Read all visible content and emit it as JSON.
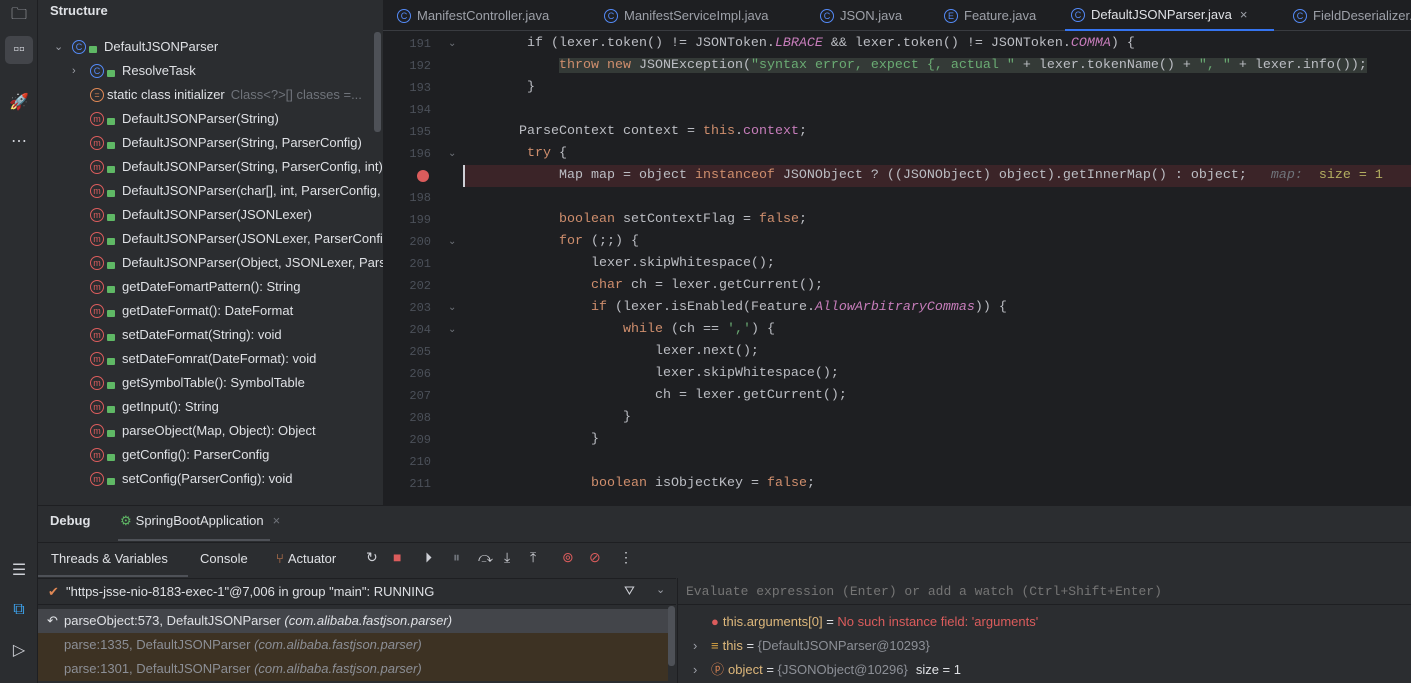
{
  "sidebar_icons": [
    "folder-icon",
    "structure-icon",
    "jrebel-icon",
    "more-icon"
  ],
  "sidebar_bottom_icons": [
    "list-icon",
    "code-with-me-icon",
    "run-icon"
  ],
  "structure": {
    "title": "Structure",
    "items": [
      {
        "kind": "c",
        "label": "DefaultJSONParser",
        "arrow": "⌄",
        "indent": 0
      },
      {
        "kind": "c",
        "label": "ResolveTask",
        "arrow": "›",
        "indent": 1
      },
      {
        "kind": "s",
        "label": "static class initializer",
        "hint": "Class<?>[] classes =...",
        "indent": 1
      },
      {
        "kind": "m",
        "label": "DefaultJSONParser(String)",
        "indent": 1
      },
      {
        "kind": "m",
        "label": "DefaultJSONParser(String, ParserConfig)",
        "indent": 1
      },
      {
        "kind": "m",
        "label": "DefaultJSONParser(String, ParserConfig, int)",
        "indent": 1
      },
      {
        "kind": "m",
        "label": "DefaultJSONParser(char[], int, ParserConfig, int)",
        "indent": 1
      },
      {
        "kind": "m",
        "label": "DefaultJSONParser(JSONLexer)",
        "indent": 1
      },
      {
        "kind": "m",
        "label": "DefaultJSONParser(JSONLexer, ParserConfig)",
        "indent": 1
      },
      {
        "kind": "m",
        "label": "DefaultJSONParser(Object, JSONLexer, ParserConfig)",
        "indent": 1
      },
      {
        "kind": "m",
        "label": "getDateFomartPattern(): String",
        "indent": 1
      },
      {
        "kind": "m",
        "label": "getDateFormat(): DateFormat",
        "indent": 1
      },
      {
        "kind": "m",
        "label": "setDateFormat(String): void",
        "indent": 1
      },
      {
        "kind": "m",
        "label": "setDateFomrat(DateFormat): void",
        "indent": 1
      },
      {
        "kind": "m",
        "label": "getSymbolTable(): SymbolTable",
        "indent": 1
      },
      {
        "kind": "m",
        "label": "getInput(): String",
        "indent": 1
      },
      {
        "kind": "m",
        "label": "parseObject(Map, Object): Object",
        "indent": 1
      },
      {
        "kind": "m",
        "label": "getConfig(): ParserConfig",
        "indent": 1
      },
      {
        "kind": "m",
        "label": "setConfig(ParserConfig): void",
        "indent": 1
      }
    ]
  },
  "tabs": [
    {
      "label": "ManifestController.java",
      "icon": "C"
    },
    {
      "label": "ManifestServiceImpl.java",
      "icon": "C"
    },
    {
      "label": "JSON.java",
      "icon": "C"
    },
    {
      "label": "Feature.java",
      "icon": "E"
    },
    {
      "label": "DefaultJSONParser.java",
      "icon": "C",
      "active": true
    },
    {
      "label": "FieldDeserializer.java",
      "icon": "C"
    }
  ],
  "editor": {
    "lines": [
      {
        "n": "191",
        "fold": true,
        "t": [
          [
            "       if (lexer.token() != JSONToken.",
            ""
          ],
          [
            "LBRACE",
            "const"
          ],
          [
            " && lexer.token() != JSONToken.",
            ""
          ],
          [
            "COMMA",
            "const"
          ],
          [
            ") {",
            ""
          ]
        ]
      },
      {
        "n": "192",
        "hl": true,
        "t": [
          [
            "           ",
            ""
          ],
          [
            "throw new ",
            "kw"
          ],
          [
            "JSONException(",
            ""
          ],
          [
            "\"syntax error, expect {, actual \"",
            "str"
          ],
          [
            " + lexer.tokenName() + ",
            ""
          ],
          [
            "\", \"",
            "str"
          ],
          [
            " + lexer.info());",
            ""
          ]
        ]
      },
      {
        "n": "193",
        "t": [
          [
            "       }",
            ""
          ]
        ]
      },
      {
        "n": "194",
        "t": []
      },
      {
        "n": "195",
        "t": [
          [
            "      ParseContext context = ",
            ""
          ],
          [
            "this",
            "kw"
          ],
          [
            ".",
            ""
          ],
          [
            "context",
            "fld"
          ],
          [
            ";",
            ""
          ]
        ]
      },
      {
        "n": "196",
        "fold": true,
        "t": [
          [
            "       ",
            ""
          ],
          [
            "try",
            "kw"
          ],
          [
            " {",
            ""
          ]
        ]
      },
      {
        "n": "",
        "bp": true,
        "t": [
          [
            "           Map map = object ",
            ""
          ],
          [
            "instanceof",
            "kw"
          ],
          [
            " JSONObject ? ((JSONObject) object).getInnerMap() : object;",
            ""
          ],
          [
            "   map:",
            "inl"
          ],
          [
            "  size = 1",
            "inlv"
          ]
        ]
      },
      {
        "n": "198",
        "t": []
      },
      {
        "n": "199",
        "t": [
          [
            "           ",
            ""
          ],
          [
            "boolean",
            "kw"
          ],
          [
            " setContextFlag = ",
            ""
          ],
          [
            "false",
            "kw"
          ],
          [
            ";",
            ""
          ]
        ]
      },
      {
        "n": "200",
        "fold": true,
        "t": [
          [
            "           ",
            ""
          ],
          [
            "for",
            "kw"
          ],
          [
            " (;;) {",
            ""
          ]
        ]
      },
      {
        "n": "201",
        "t": [
          [
            "               lexer.skipWhitespace();",
            ""
          ]
        ]
      },
      {
        "n": "202",
        "t": [
          [
            "               ",
            ""
          ],
          [
            "char",
            "kw"
          ],
          [
            " ch = lexer.getCurrent();",
            ""
          ]
        ]
      },
      {
        "n": "203",
        "fold": true,
        "t": [
          [
            "               ",
            ""
          ],
          [
            "if",
            "kw"
          ],
          [
            " (lexer.isEnabled(Feature.",
            ""
          ],
          [
            "AllowArbitraryCommas",
            "const"
          ],
          [
            ")) {",
            ""
          ]
        ]
      },
      {
        "n": "204",
        "fold": true,
        "t": [
          [
            "                   ",
            ""
          ],
          [
            "while",
            "kw"
          ],
          [
            " (ch == ",
            ""
          ],
          [
            "','",
            "str"
          ],
          [
            ") {",
            ""
          ]
        ]
      },
      {
        "n": "205",
        "t": [
          [
            "                       lexer.next();",
            ""
          ]
        ]
      },
      {
        "n": "206",
        "t": [
          [
            "                       lexer.skipWhitespace();",
            ""
          ]
        ]
      },
      {
        "n": "207",
        "t": [
          [
            "                       ch = lexer.getCurrent();",
            ""
          ]
        ]
      },
      {
        "n": "208",
        "t": [
          [
            "                   }",
            ""
          ]
        ]
      },
      {
        "n": "209",
        "t": [
          [
            "               }",
            ""
          ]
        ]
      },
      {
        "n": "210",
        "t": []
      },
      {
        "n": "211",
        "t": [
          [
            "               ",
            ""
          ],
          [
            "boolean",
            "kw"
          ],
          [
            " isObjectKey = ",
            ""
          ],
          [
            "false",
            "kw"
          ],
          [
            ";",
            ""
          ]
        ]
      }
    ]
  },
  "debug": {
    "title": "Debug",
    "session": "SpringBootApplication",
    "subtabs": [
      "Threads & Variables",
      "Console",
      "Actuator"
    ],
    "toolbar": [
      "rerun-icon",
      "stop-icon",
      "resume-icon",
      "pause-icon",
      "step-over-icon",
      "step-into-icon",
      "step-out-icon",
      "view-breakpoints-icon",
      "mute-breakpoints-icon",
      "more-icon"
    ],
    "thread": "\"https-jsse-nio-8183-exec-1\"@7,006 in group \"main\": RUNNING",
    "frames": [
      {
        "method": "parseObject:573, DefaultJSONParser",
        "pkg": "(com.alibaba.fastjson.parser)",
        "current": true
      },
      {
        "method": "parse:1335, DefaultJSONParser",
        "pkg": "(com.alibaba.fastjson.parser)"
      },
      {
        "method": "parse:1301, DefaultJSONParser",
        "pkg": "(com.alibaba.fastjson.parser)"
      }
    ],
    "evaluate_placeholder": "Evaluate expression (Enter) or add a watch (Ctrl+Shift+Enter)",
    "variables": [
      {
        "name": "this.arguments[0]",
        "eq": " = ",
        "value": "No such instance field: 'arguments'",
        "error": true
      },
      {
        "name": "this",
        "eq": " = ",
        "value": "{DefaultJSONParser@10293}",
        "icon": "field"
      },
      {
        "name": "object",
        "eq": " = ",
        "value": "{JSONObject@10296}",
        "extra": "size = 1",
        "icon": "param"
      }
    ]
  },
  "colors": {
    "accent": "#3574F0",
    "keyword": "#CF8E6D",
    "string": "#6AAB73",
    "constant": "#C77DBB",
    "breakpoint_line": "#3B2428",
    "error": "#DB5C5C"
  }
}
